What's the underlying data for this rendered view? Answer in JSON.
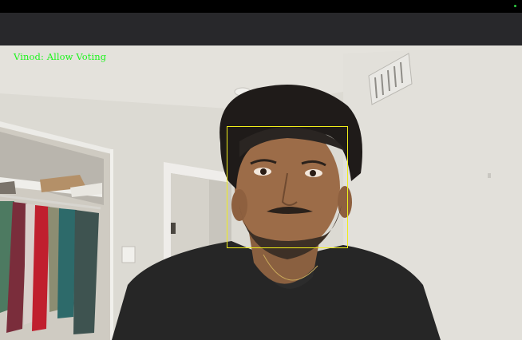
{
  "window": {
    "title_strip": ""
  },
  "camera_feed": {
    "overlay_label": "Vinod: Allow Voting",
    "overlay_color": "#1cf51c",
    "face_box_color": "#f0ee1a"
  },
  "indicator": {
    "camera_active_color": "#2ecc40"
  }
}
